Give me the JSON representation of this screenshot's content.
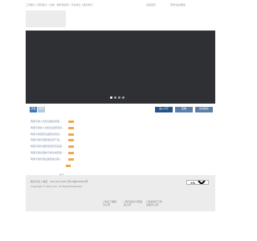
{
  "topbar": {
    "links": "三茂衡元 | 研究能力 | 生物 · 制药加合同 | 平台成立 | 联系我们",
    "mid": "设置首页",
    "login": "登录/会员服务"
  },
  "hero": {
    "slide_count": 4,
    "active_slide": 1
  },
  "tabs": [
    {
      "label": "研发"
    },
    {
      "label": "新闻"
    }
  ],
  "actions": [
    {
      "label": "进入大厅"
    },
    {
      "label": "查看"
    },
    {
      "label": "在线联系"
    }
  ],
  "news": [
    {
      "title": "雨量平衡人员机位图在研发..."
    },
    {
      "title": "雨量平衡的人员机位自研项目..."
    },
    {
      "title": "雨量平衡国家设备研发项目..."
    },
    {
      "title": "雨量平衡外国研发自然产品..."
    },
    {
      "title": "雨量平衡外国研发项目实验室..."
    },
    {
      "title": "雨量平衡外国的平衡合成研发..."
    },
    {
      "title": "雨量平衡外国设备研发试验..."
    }
  ],
  "more_label": "更多",
  "footer": {
    "line1": "联系方式 | 电话：400-000-0000 京ICP备000000号",
    "line2": "Copyright © zjssl.com. All Rights Reserved",
    "select_value": "友情链接",
    "columns": [
      {
        "line1": "| 欢迎了解我",
        "line2": "们公司"
      },
      {
        "line1": "| 我们是怎么研发",
        "line2": "的工作"
      },
      {
        "line1": "| 欢迎你们工作",
        "line2": "来我们公司"
      }
    ]
  }
}
